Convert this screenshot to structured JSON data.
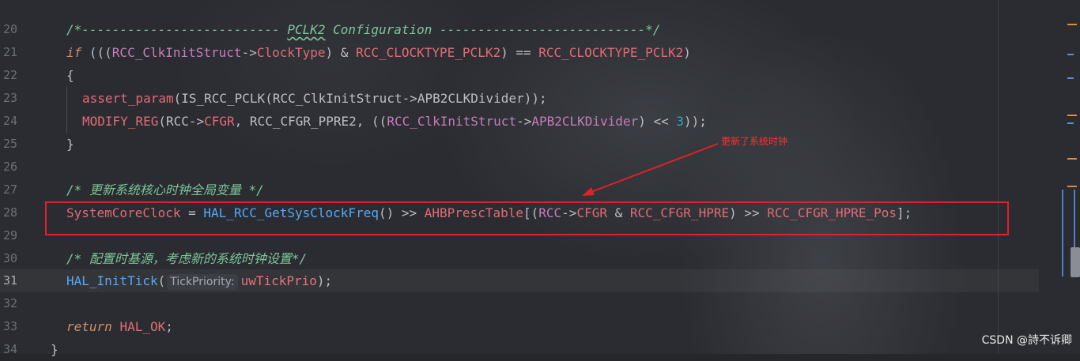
{
  "editor": {
    "line_numbers": [
      "20",
      "21",
      "22",
      "23",
      "24",
      "25",
      "26",
      "27",
      "28",
      "29",
      "30",
      "31",
      "32",
      "33",
      "34"
    ],
    "lines": {
      "l20": {
        "comment": "/*-------------------------- ",
        "pclk2": "PCLK2",
        "rest": " Configuration ---------------------------*/"
      },
      "l21": {
        "if": "if",
        "p1": " (((",
        "s1": "RCC_ClkInitStruct",
        "a1": "->",
        "f1": "ClockType",
        "p2": ") & ",
        "c1": "RCC_CLOCKTYPE_PCLK2",
        "p3": ") == ",
        "c2": "RCC_CLOCKTYPE_PCLK2",
        "p4": ")"
      },
      "l22": {
        "text": "{"
      },
      "l23": {
        "m1": "assert_param",
        "p1": "(IS_RCC_PCLK(RCC_ClkInitStruct->APB2CLKDivider));"
      },
      "l24": {
        "m1": "MODIFY_REG",
        "p1": "(RCC->",
        "f1": "CFGR",
        "p2": ", RCC_CFGR_PPRE2, ((",
        "s1": "RCC_ClkInitStruct",
        "a1": "->",
        "f2": "APB2CLKDivider",
        "p3": ") << ",
        "n1": "3",
        "p4": "));"
      },
      "l25": {
        "text": "}"
      },
      "l27": {
        "comment": "/* 更新系统核心时钟全局变量 */"
      },
      "l28": {
        "v1": "SystemCoreClock",
        "p1": " = ",
        "fn1": "HAL_RCC_GetSysClockFreq",
        "p2": "() >> ",
        "v2": "AHBPrescTable",
        "p3": "[(",
        "c1": "RCC",
        "a1": "->",
        "f1": "CFGR",
        "p4": " & ",
        "c2": "RCC_CFGR_HPRE",
        "p5": ") >> ",
        "c3": "RCC_CFGR_HPRE_Pos",
        "p6": "];"
      },
      "l30": {
        "comment": "/* 配置时基源，考虑新的系统时钟设置*/"
      },
      "l31": {
        "fn1": "HAL_InitTick",
        "p1": "(",
        "hint": "TickPriority:",
        "param": "uwTickPrio",
        "p2": ");"
      },
      "l33": {
        "kw": "return",
        "p1": " ",
        "c1": "HAL_OK",
        "p2": ";"
      },
      "l34": {
        "text": "}"
      }
    }
  },
  "annotation": {
    "text": "更新了系统时钟",
    "color": "#ff3030"
  },
  "watermark": {
    "text": "CSDN @詩不诉卿"
  }
}
